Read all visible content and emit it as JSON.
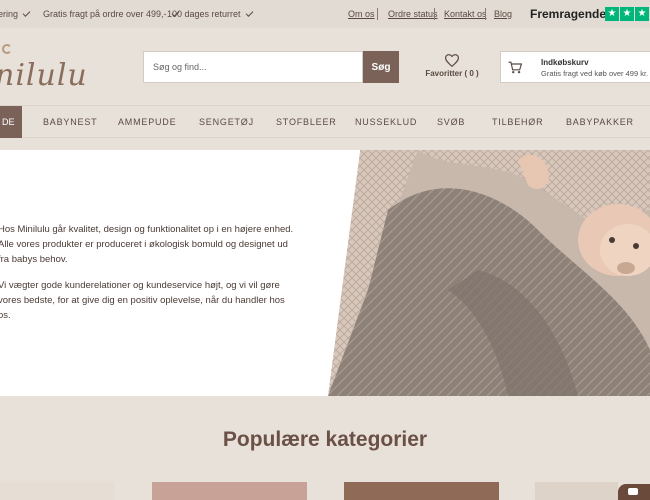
{
  "topbar": {
    "usp": [
      "ering",
      "Gratis fragt på ordre over 499,-",
      "100 dages returret"
    ],
    "links": [
      "Om os",
      "Ordre status",
      "Kontakt os",
      "Blog"
    ],
    "trustpilot": "Fremragende"
  },
  "header": {
    "logo": "nilulu",
    "search": {
      "placeholder": "Søg og find...",
      "button": "Søg"
    },
    "favorites": "Favoritter ( 0 )",
    "cart": {
      "title": "Indkøbskurv",
      "subtitle": "Gratis fragt ved køb over 499 kr."
    }
  },
  "nav": {
    "active": "DE",
    "items": [
      "BABYNEST",
      "AMMEPUDE",
      "SENGETØJ",
      "STOFBLEER",
      "NUSSEKLUD",
      "SVØB",
      "TILBEHØR",
      "BABYPAKKER"
    ]
  },
  "hero": {
    "line1": "Hos Minilulu går kvalitet, design og funktionalitet op i en højere enhed. Alle vores produkter er produceret i økologisk bomuld og designet ud fra babys behov.",
    "line2": "Vi vægter gode kunderelationer og kundeservice højt, og vi vil gøre vores bedste, for at give dig en positiv oplevelse, når du handler hos os."
  },
  "categories": {
    "title": "Populære kategorier"
  },
  "colors": {
    "accent": "#7a6259",
    "background": "#e8e1d9",
    "trustpilot": "#00b67a"
  }
}
